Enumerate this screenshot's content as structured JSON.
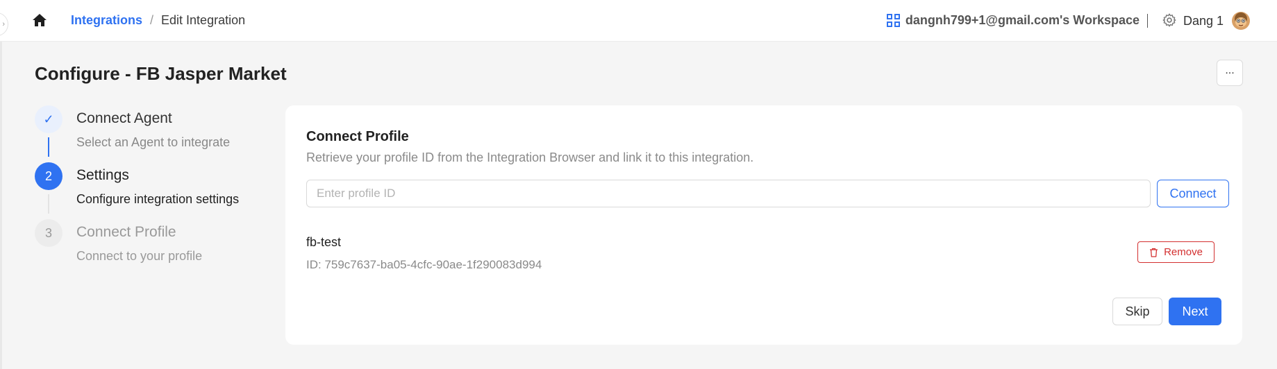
{
  "breadcrumb": {
    "parent": "Integrations",
    "separator": "/",
    "current": "Edit Integration"
  },
  "header": {
    "workspace": "dangnh799+1@gmail.com's Workspace",
    "user_name": "Dang 1"
  },
  "page": {
    "title": "Configure - FB Jasper Market",
    "more_label": "..."
  },
  "steps": [
    {
      "number": "✓",
      "title": "Connect Agent",
      "description": "Select an Agent to integrate",
      "state": "done"
    },
    {
      "number": "2",
      "title": "Settings",
      "description": "Configure integration settings",
      "state": "active"
    },
    {
      "number": "3",
      "title": "Connect Profile",
      "description": "Connect to your profile",
      "state": "pending"
    }
  ],
  "card": {
    "title": "Connect Profile",
    "subtitle": "Retrieve your profile ID from the Integration Browser and link it to this integration.",
    "input_placeholder": "Enter profile ID",
    "input_value": "",
    "connect_label": "Connect",
    "profile": {
      "name": "fb-test",
      "id_text": "ID: 759c7637-ba05-4cfc-90ae-1f290083d994"
    },
    "remove_label": "Remove",
    "skip_label": "Skip",
    "next_label": "Next"
  },
  "colors": {
    "accent": "#2f72f1",
    "danger": "#d32f2f",
    "page_bg": "#f5f5f5"
  }
}
